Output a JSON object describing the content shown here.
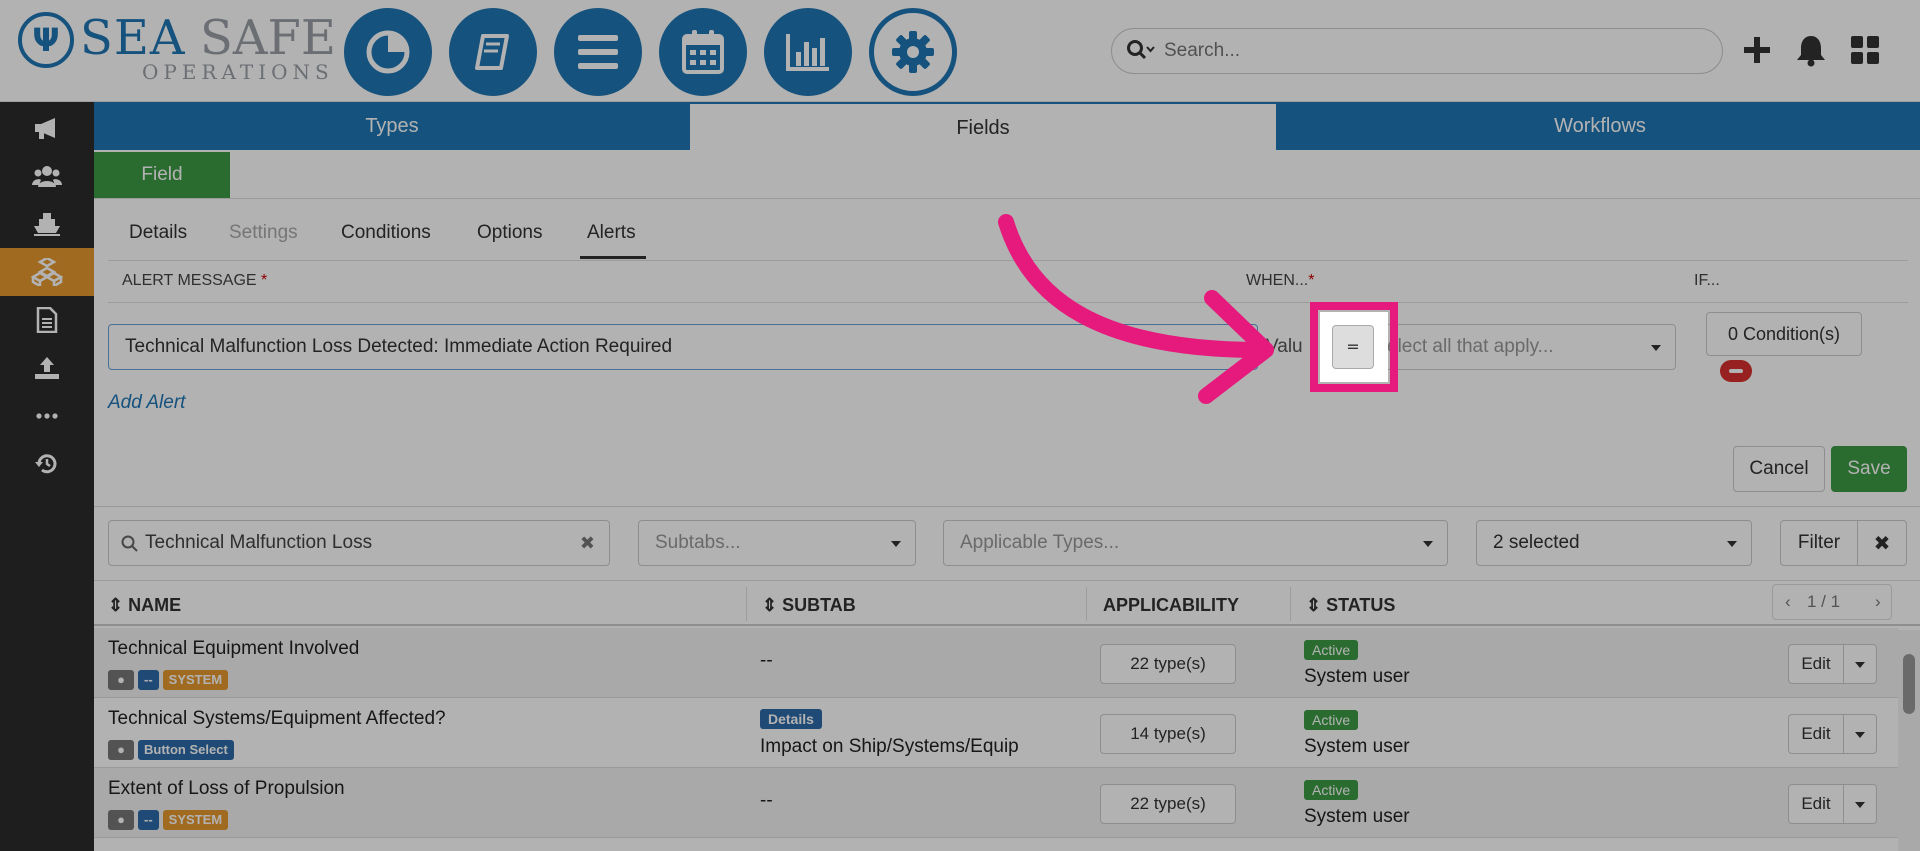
{
  "brand": {
    "sea": "SEA",
    "safe": "SAFE",
    "ops": "OPERATIONS"
  },
  "header": {
    "nav": [
      {
        "name": "dashboard",
        "icon": "pie-chart-icon"
      },
      {
        "name": "library",
        "icon": "book-icon"
      },
      {
        "name": "menu",
        "icon": "list-icon"
      },
      {
        "name": "calendar",
        "icon": "calendar-icon"
      },
      {
        "name": "reports",
        "icon": "bar-chart-icon"
      },
      {
        "name": "settings",
        "icon": "gear-icon",
        "active": true
      }
    ],
    "search_placeholder": "Search...",
    "icons": [
      "plus-icon",
      "bell-icon",
      "apps-grid-icon"
    ]
  },
  "sidebar": [
    "megaphone-icon",
    "users-icon",
    "ship-icon",
    "cubes-icon",
    "document-icon",
    "upload-icon",
    "more-icon",
    "history-icon"
  ],
  "tabs": {
    "types": "Types",
    "fields": "Fields",
    "workflows": "Workflows"
  },
  "field_button": "Field",
  "subtabs": {
    "details": "Details",
    "settings": "Settings",
    "conditions": "Conditions",
    "options": "Options",
    "alerts": "Alerts"
  },
  "alert_form": {
    "col_message": "ALERT MESSAGE",
    "col_when": "WHEN...",
    "col_if": "IF...",
    "required_mark": "*",
    "message_value": "Technical Malfunction Loss Detected: Immediate Action Required",
    "value_label": "Valu",
    "operator": "=",
    "applies_placeholder": "elect all that apply...",
    "conditions_button": "0 Condition(s)",
    "add_alert": "Add Alert",
    "cancel": "Cancel",
    "save": "Save"
  },
  "filters": {
    "search_value": "Technical Malfunction Loss",
    "subtabs_placeholder": "Subtabs...",
    "types_placeholder": "Applicable Types...",
    "status_value": "2 selected",
    "filter_button": "Filter"
  },
  "table": {
    "headers": {
      "name": "NAME",
      "subtab": "SUBTAB",
      "applicability": "APPLICABILITY",
      "status": "STATUS"
    },
    "pager": "1 / 1",
    "rows": [
      {
        "name": "Technical Equipment Involved",
        "badge2": "--",
        "badge3": "SYSTEM",
        "subtab": "--",
        "types": "22 type(s)",
        "status": "Active",
        "user": "System user",
        "edit": "Edit"
      },
      {
        "name": "Technical Systems/Equipment Affected?",
        "badge2": "Button Select",
        "subtab_badge": "Details",
        "subtab": "Impact on Ship/Systems/Equip",
        "types": "14 type(s)",
        "status": "Active",
        "user": "System user",
        "edit": "Edit"
      },
      {
        "name": "Extent of Loss of Propulsion",
        "badge2": "--",
        "badge3": "SYSTEM",
        "subtab": "--",
        "types": "22 type(s)",
        "status": "Active",
        "user": "System user",
        "edit": "Edit"
      }
    ]
  },
  "colors": {
    "primary": "#1f76b3",
    "success": "#3d9b45",
    "highlight": "#e6197c",
    "sidebar_active": "#e69a2f"
  }
}
